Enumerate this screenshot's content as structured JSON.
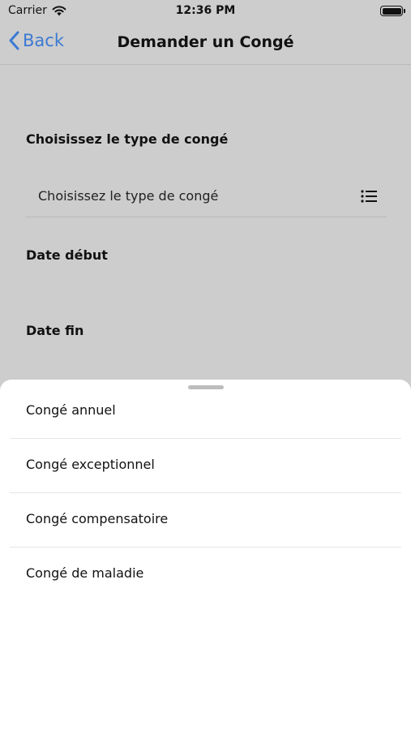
{
  "status_bar": {
    "carrier": "Carrier",
    "time": "12:36 PM",
    "icons": [
      "wifi-icon",
      "battery-icon"
    ]
  },
  "nav": {
    "back_label": "Back",
    "title": "Demander un Congé",
    "accent_color": "#3b7ad4"
  },
  "form": {
    "type_label": "Choisissez le type de congé",
    "type_placeholder": "Choisissez le type de congé",
    "start_label": "Date début",
    "end_label": "Date fin"
  },
  "sheet": {
    "options": [
      "Congé annuel",
      "Congé exceptionnel",
      "Congé compensatoire",
      "Congé de maladie"
    ]
  }
}
